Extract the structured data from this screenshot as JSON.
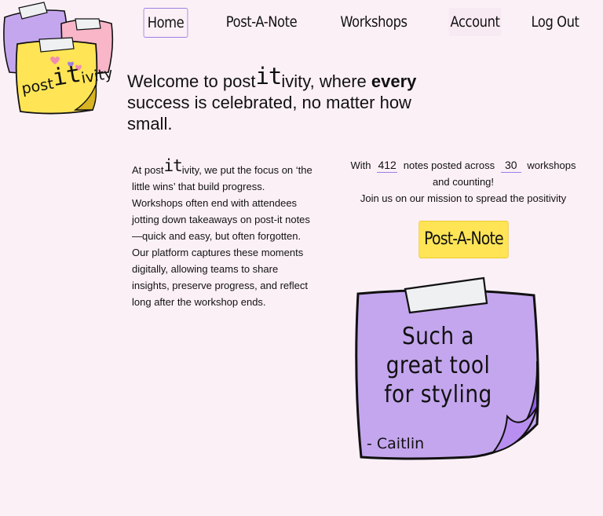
{
  "logo": {
    "prefix": "post",
    "it": "it",
    "suffix": "ivity"
  },
  "nav": {
    "items": [
      {
        "label": "Home",
        "active": true
      },
      {
        "label": "Post-A-Note"
      },
      {
        "label": "Workshops"
      },
      {
        "label": "Account"
      },
      {
        "label": "Log Out"
      }
    ]
  },
  "hero": {
    "line_a": "Welcome to post",
    "it": "it",
    "line_b": "ivity, where ",
    "bold": "every",
    "line_c": " success is celebrated, no matter how small."
  },
  "about": {
    "prefix": "At post",
    "it": "it",
    "text": "ivity, we put the focus on ‘the little wins’ that build progress. Workshops often end with attendees jotting down takeaways on post-it notes—quick and easy, but often forgotten. Our platform captures these moments digitally, allowing teams to share insights, preserve progress, and reflect long after the workshop ends."
  },
  "stats": {
    "with": "With",
    "notes_count": "412",
    "notes_text": "notes posted across",
    "workshops_count": "30",
    "workshops_text": "workshops and counting!",
    "mission": "Join us on our mission to spread the positivity"
  },
  "cta": {
    "label": "Post-A-Note"
  },
  "quote": {
    "line1": "Such a",
    "line2": "great tool",
    "line3": "for styling",
    "author": "- Caitlin"
  },
  "colors": {
    "background": "#fcf0f7",
    "accent_purple": "#9d7fe0",
    "note_yellow": "#ffe555",
    "note_lavender": "#c4a6ee",
    "note_pink": "#f8b6c8"
  }
}
